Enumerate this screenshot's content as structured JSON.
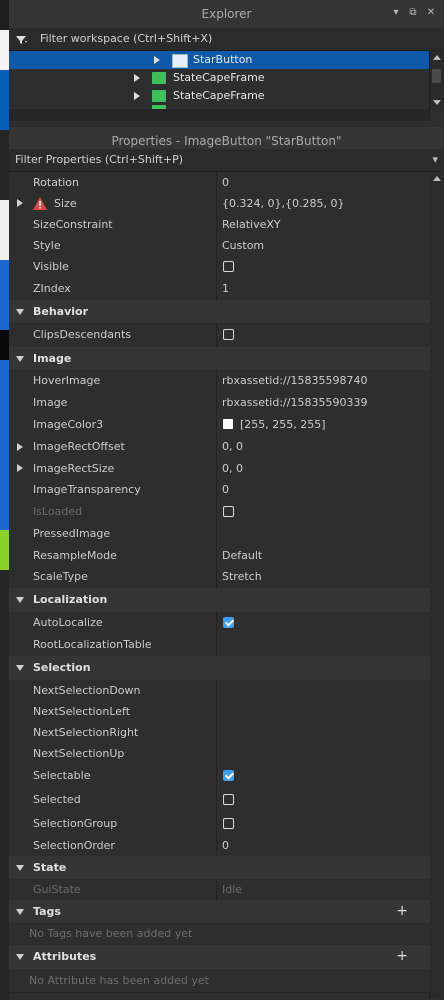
{
  "explorer": {
    "title": "Explorer",
    "filter_placeholder": "Filter workspace (Ctrl+Shift+X)",
    "items": [
      {
        "label": "StarButton",
        "selected": true
      },
      {
        "label": "StateCapeFrame"
      },
      {
        "label": "StateCapeFrame"
      }
    ]
  },
  "properties": {
    "title": "Properties - ImageButton \"StarButton\"",
    "filter_placeholder": "Filter Properties (Ctrl+Shift+P)",
    "rows": {
      "rotation": {
        "name": "Rotation",
        "value": "0"
      },
      "size": {
        "name": "Size",
        "value": "{0.324, 0},{0.285, 0}"
      },
      "sizeconstraint": {
        "name": "SizeConstraint",
        "value": "RelativeXY"
      },
      "style": {
        "name": "Style",
        "value": "Custom"
      },
      "visible": {
        "name": "Visible",
        "checked": false
      },
      "zindex": {
        "name": "ZIndex",
        "value": "1"
      },
      "clipsdescendants": {
        "name": "ClipsDescendants",
        "checked": false
      },
      "hoverimage": {
        "name": "HoverImage",
        "value": "rbxassetid://15835598740"
      },
      "image": {
        "name": "Image",
        "value": "rbxassetid://15835590339"
      },
      "imagecolor3": {
        "name": "ImageColor3",
        "value": "[255, 255, 255]"
      },
      "imagerectoffset": {
        "name": "ImageRectOffset",
        "value": "0, 0"
      },
      "imagerectsize": {
        "name": "ImageRectSize",
        "value": "0, 0"
      },
      "imagetransparency": {
        "name": "ImageTransparency",
        "value": "0"
      },
      "isloaded": {
        "name": "IsLoaded",
        "checked": false
      },
      "pressedimage": {
        "name": "PressedImage",
        "value": ""
      },
      "resamplemode": {
        "name": "ResampleMode",
        "value": "Default"
      },
      "scaletype": {
        "name": "ScaleType",
        "value": "Stretch"
      },
      "autolocalize": {
        "name": "AutoLocalize",
        "checked": true
      },
      "rootlocalizationtable": {
        "name": "RootLocalizationTable",
        "value": ""
      },
      "nextselectiondown": {
        "name": "NextSelectionDown",
        "value": ""
      },
      "nextselectionleft": {
        "name": "NextSelectionLeft",
        "value": ""
      },
      "nextselectionright": {
        "name": "NextSelectionRight",
        "value": ""
      },
      "nextselectionup": {
        "name": "NextSelectionUp",
        "value": ""
      },
      "selectable": {
        "name": "Selectable",
        "checked": true
      },
      "selected": {
        "name": "Selected",
        "checked": false
      },
      "selectiongroup": {
        "name": "SelectionGroup",
        "checked": false
      },
      "selectionorder": {
        "name": "SelectionOrder",
        "value": "0"
      },
      "guistate": {
        "name": "GuiState",
        "value": "Idle"
      }
    },
    "categories": {
      "behavior": "Behavior",
      "image": "Image",
      "localization": "Localization",
      "selection": "Selection",
      "state": "State",
      "tags": "Tags",
      "attributes": "Attributes"
    },
    "tags_empty": "No Tags have been added yet",
    "attributes_empty": "No Attribute has been added yet"
  },
  "colors": {
    "selection_blue": "#0f5aa8",
    "checkbox_blue": "#3aa0f3",
    "warning": "#e04848",
    "image_icon_green": "#3fbf5a"
  }
}
